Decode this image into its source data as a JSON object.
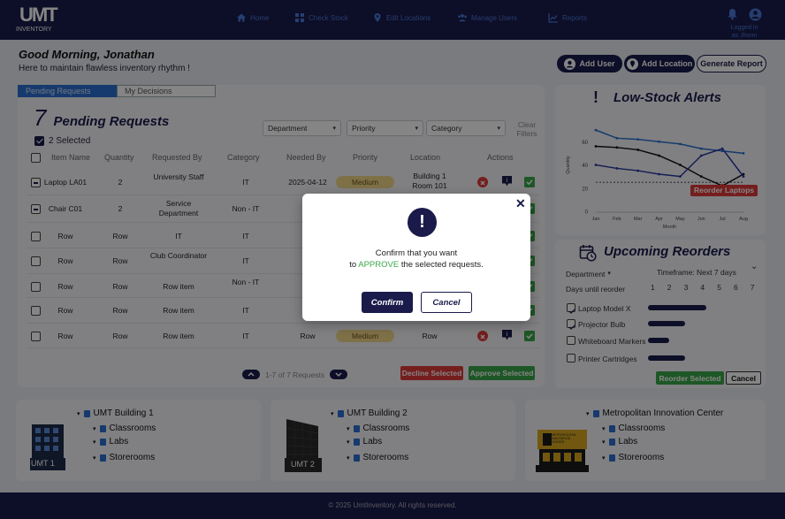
{
  "app": {
    "logo_text": "UMT",
    "logo_sub": "INVENTORY"
  },
  "nav": {
    "items": [
      {
        "label": "Home",
        "icon": "home-icon"
      },
      {
        "label": "Check Stock",
        "icon": "grid-icon"
      },
      {
        "label": "Edit Locations",
        "icon": "location-pin-icon"
      },
      {
        "label": "Manage Users",
        "icon": "users-icon"
      },
      {
        "label": "Reports",
        "icon": "chart-icon"
      }
    ],
    "login_text": "Logged in as Jhonn"
  },
  "greeting": {
    "title": "Good Morning, Jonathan",
    "subtitle": "Here to maintain flawless inventory rhythm !"
  },
  "header_buttons": {
    "add_user": "Add User",
    "add_location": "Add Location",
    "generate_report": "Generate Report"
  },
  "requests": {
    "tabs": [
      "Pending Requests",
      "My Decisions"
    ],
    "count": "7",
    "title": "Pending Requests",
    "filters": [
      "Department",
      "Priority",
      "Category"
    ],
    "clear_filters": "Clear Filters",
    "selected_text": "2 Selected",
    "columns": [
      "Item Name",
      "Quantity",
      "Requested By",
      "Category",
      "Needed By",
      "Priority",
      "Location",
      "Actions"
    ],
    "rows": [
      {
        "item": "Laptop LA01",
        "qty": "2",
        "by": "University Staff",
        "cat": "IT",
        "needed": "2025-04-12",
        "priority": "Medium",
        "location": "Building 1 Room 101"
      },
      {
        "item": "Chair C01",
        "qty": "2",
        "by": "Service Department",
        "cat": "Non - IT",
        "needed": "R",
        "priority": "",
        "location": ""
      },
      {
        "item": "Row",
        "qty": "Row",
        "by": "IT",
        "cat": "IT",
        "needed": "R",
        "priority": "",
        "location": ""
      },
      {
        "item": "Row",
        "qty": "Row",
        "by": "Club Coordinator",
        "cat": "IT",
        "needed": "R",
        "priority": "",
        "location": ""
      },
      {
        "item": "Row",
        "qty": "Row",
        "by": "Row item",
        "cat": "Non - IT",
        "needed": "R",
        "priority": "",
        "location": ""
      },
      {
        "item": "Row",
        "qty": "Row",
        "by": "Row item",
        "cat": "IT",
        "needed": "R",
        "priority": "",
        "location": ""
      },
      {
        "item": "Row",
        "qty": "Row",
        "by": "Row item",
        "cat": "IT",
        "needed": "Row",
        "priority": "Medium",
        "location": "Row"
      }
    ],
    "pager_text": "1-7 of 7 Requests",
    "decline_label": "Decline Selected",
    "approve_label": "Approve Selected"
  },
  "alerts": {
    "title": "Low-Stock Alerts",
    "reorder_tag": "Reorder Laptops"
  },
  "chart_data": {
    "type": "line",
    "title": "",
    "xlabel": "Month",
    "ylabel": "Quantity",
    "categories": [
      "Jan",
      "Feb",
      "Mar",
      "Apr",
      "May",
      "Jun",
      "Jul",
      "Aug"
    ],
    "ylim": [
      0,
      80
    ],
    "yticks": [
      "0",
      "20",
      "40",
      "60"
    ],
    "series": [
      {
        "values": [
          70,
          63,
          62,
          60,
          58,
          54,
          52,
          50
        ],
        "color": "#2b6fd1"
      },
      {
        "values": [
          56,
          55,
          53,
          48,
          40,
          30,
          22,
          32
        ],
        "color": "#111111"
      },
      {
        "values": [
          40,
          37,
          35,
          32,
          30,
          48,
          54,
          30
        ],
        "color": "#2b3aa0"
      }
    ],
    "threshold": 25
  },
  "reorders": {
    "title": "Upcoming Reorders",
    "department": "Department",
    "timeframe": "Timeframe: Next 7 days",
    "days_label": "Days until reorder",
    "days": [
      "1",
      "2",
      "3",
      "4",
      "5",
      "6",
      "7"
    ],
    "items": [
      {
        "name": "Laptop Model X",
        "checked": true,
        "bar": 0.55
      },
      {
        "name": "Projector Bulb",
        "checked": true,
        "bar": 0.35
      },
      {
        "name": "Whiteboard Markers",
        "checked": false,
        "bar": 0.2
      },
      {
        "name": "Printer Cartridges",
        "checked": false,
        "bar": 0.35
      }
    ],
    "reorder_label": "Reorder Selected",
    "cancel_label": "Cancel"
  },
  "buildings": [
    {
      "name": "UMT Building 1",
      "tag": "UMT 1",
      "rooms": [
        "Classrooms",
        "Labs",
        "Storerooms"
      ]
    },
    {
      "name": "UMT Building 2",
      "tag": "UMT 2",
      "rooms": [
        "Classrooms",
        "Labs",
        "Storerooms"
      ]
    },
    {
      "name": "Metropolitan Innovation Center",
      "tag": "METROPOLITAN INNOVATION CENTER",
      "rooms": [
        "Classrooms",
        "Labs",
        "Storerooms"
      ]
    }
  ],
  "footer": "© 2025 UmtInventory. All rights reserved.",
  "modal": {
    "line1": "Confirm that you want",
    "line2_pre": "to ",
    "line2_action": "APPROVE",
    "line2_post": " the selected requests.",
    "confirm": "Confirm",
    "cancel": "Cancel"
  }
}
